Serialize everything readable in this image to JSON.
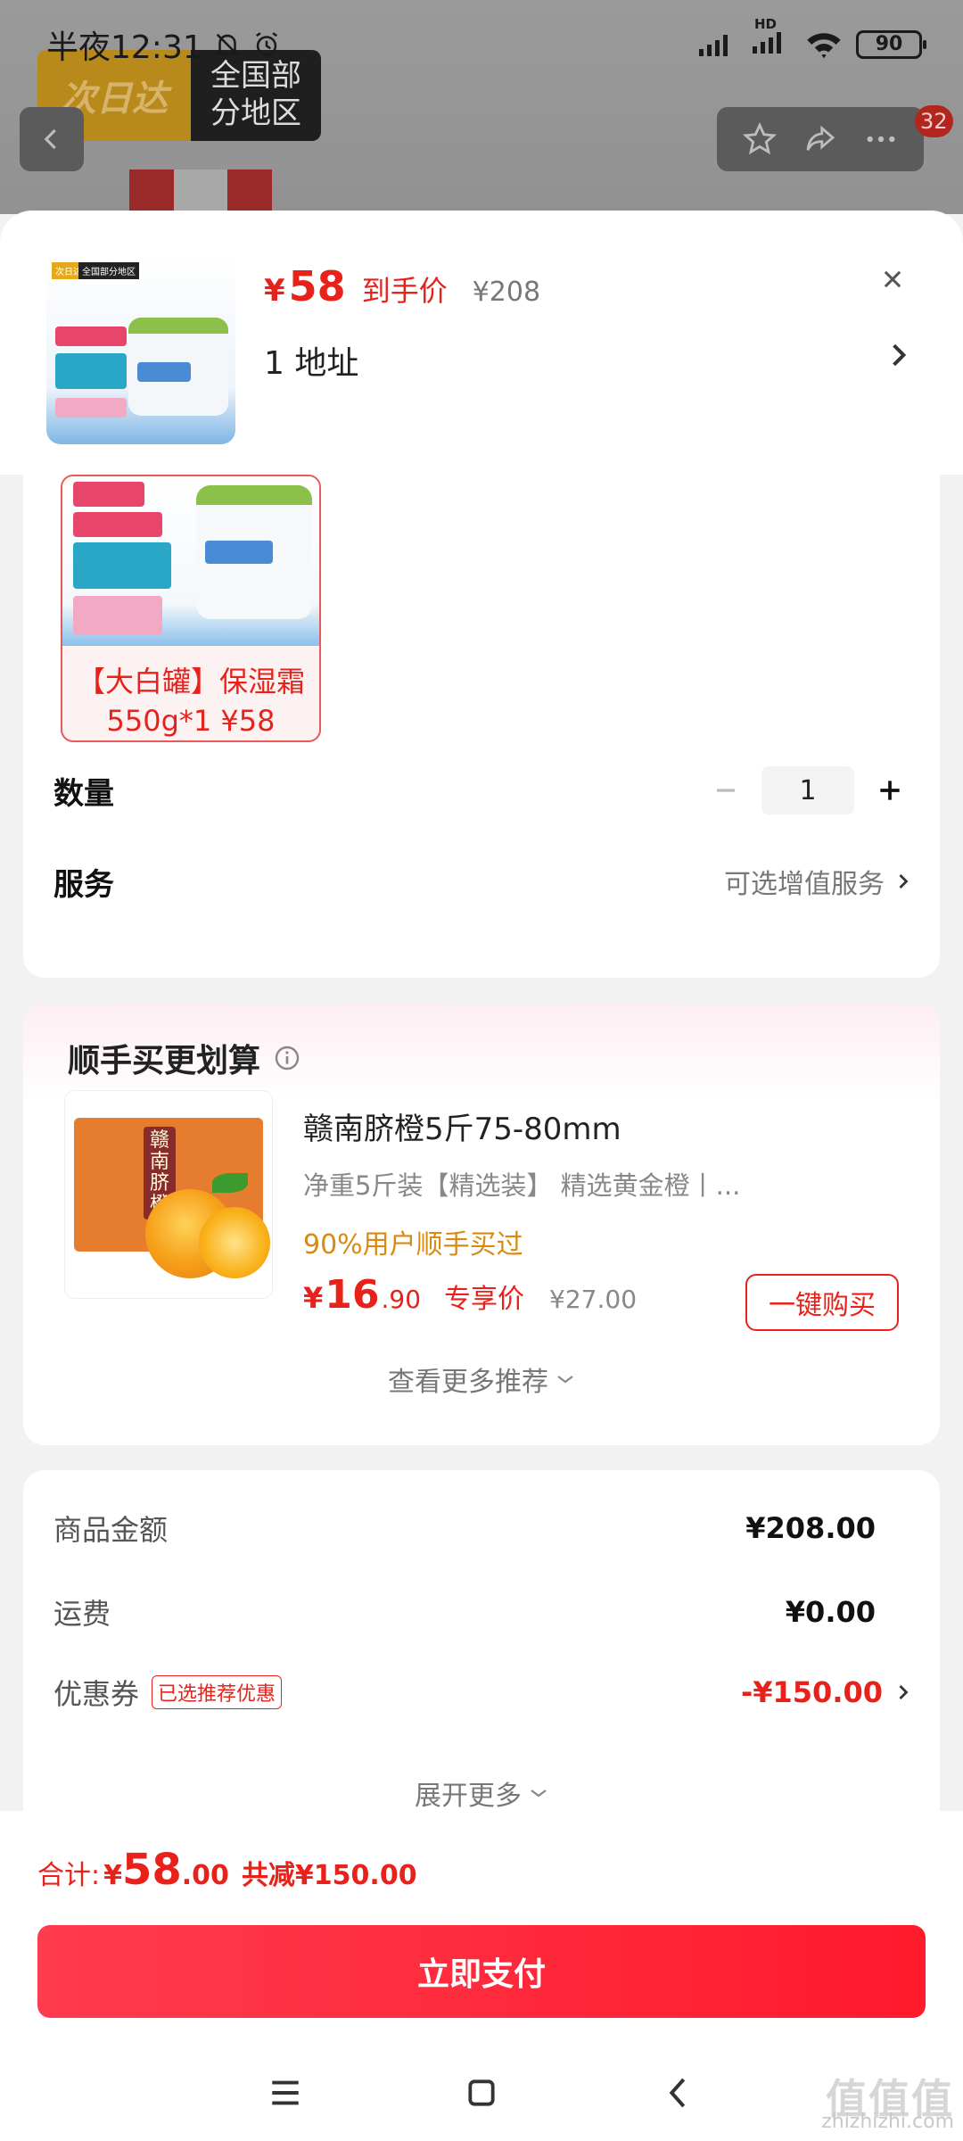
{
  "status_bar": {
    "time": "半夜12:31",
    "network": "HD",
    "battery": "90"
  },
  "background_page": {
    "badge_left": "次日达",
    "badge_right_line1": "全国部",
    "badge_right_line2": "分地区",
    "cart_count": "32"
  },
  "header": {
    "price_symbol": "¥",
    "price": "58",
    "price_tag": "到手价",
    "original_price": "¥208",
    "address": "1  地址",
    "thumb_tags": [
      "次日达",
      "全国部分地区"
    ]
  },
  "option": {
    "label_line1": "【大白罐】保湿霜",
    "label_line2": "550g*1 ¥58",
    "image_pills": [
      "加拿大进口",
      "确保正品",
      "支持7天无理由退货",
      "可涂面部",
      "锁水保湿",
      "海外版550g",
      "面部+身体"
    ]
  },
  "quantity": {
    "label": "数量",
    "value": "1"
  },
  "service": {
    "label": "服务",
    "link": "可选增值服务"
  },
  "recommend": {
    "title": "顺手买更划算",
    "item": {
      "name": "赣南脐橙5斤75-80mm",
      "desc": "净重5斤装【精选装】  精选黄金橙丨...",
      "social": "90%用户顺手买过",
      "price_symbol": "¥",
      "price_int": "16",
      "price_dec": ".90",
      "price_tag": "专享价",
      "original_price": "¥27.00",
      "buy_label": "一键购买",
      "image_text": "赣南脐橙"
    },
    "more_label": "查看更多推荐"
  },
  "summary": {
    "goods_label": "商品金额",
    "goods_value": "¥208.00",
    "shipping_label": "运费",
    "shipping_value": "¥0.00",
    "coupon_label": "优惠券",
    "coupon_tag": "已选推荐优惠",
    "coupon_value": "-¥150.00",
    "expand_label": "展开更多"
  },
  "checkout": {
    "total_label": "合计:",
    "total_symbol": "¥",
    "total_int": "58",
    "total_dec": ".00",
    "saving": "共减¥150.00",
    "pay_label": "立即支付"
  },
  "watermark": {
    "line1": "值值值",
    "line2": "zhizhizhi.com"
  },
  "colors": {
    "accent": "#e8221b",
    "pay_button": "#ff2036",
    "social_proof": "#d98a12"
  }
}
